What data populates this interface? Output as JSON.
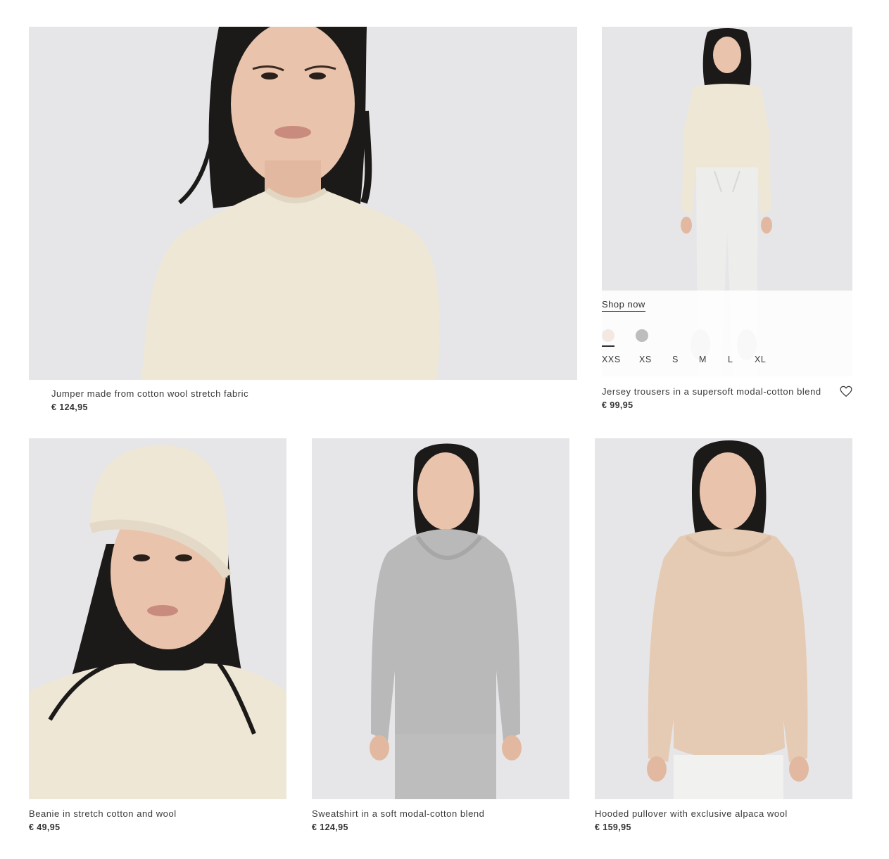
{
  "products": [
    {
      "title": "Jumper made from cotton wool stretch fabric",
      "price": "€ 124,95",
      "image": "model-in-cream-jumper-closeup"
    },
    {
      "title": "Jersey trousers in a supersoft modal-cotton blend",
      "price": "€ 99,95",
      "image": "model-in-cream-jumper-and-white-trousers",
      "quick_shop": {
        "shop_now_label": "Shop now",
        "swatches": [
          {
            "name": "off-white",
            "color": "#f2e9e3",
            "selected": true
          },
          {
            "name": "grey",
            "color": "#bdbdbd",
            "selected": false
          }
        ],
        "sizes": [
          "XXS",
          "XS",
          "S",
          "M",
          "L",
          "XL"
        ]
      },
      "wishlist_icon": "heart-outline-icon"
    },
    {
      "title": "Beanie in stretch cotton and wool",
      "price": "€ 49,95",
      "image": "model-in-cream-beanie"
    },
    {
      "title": "Sweatshirt in a soft modal-cotton blend",
      "price": "€ 124,95",
      "image": "model-in-grey-hoodie"
    },
    {
      "title": "Hooded pullover with exclusive alpaca wool",
      "price": "€ 159,95",
      "image": "model-in-beige-hooded-pullover"
    }
  ],
  "colors": {
    "photo_background": "#e6e6e8",
    "cream": "#efe7d6",
    "grey": "#b9b9b9",
    "beige": "#e6cbb4",
    "hair": "#1c1a19",
    "skin": "#e9c3ab"
  }
}
